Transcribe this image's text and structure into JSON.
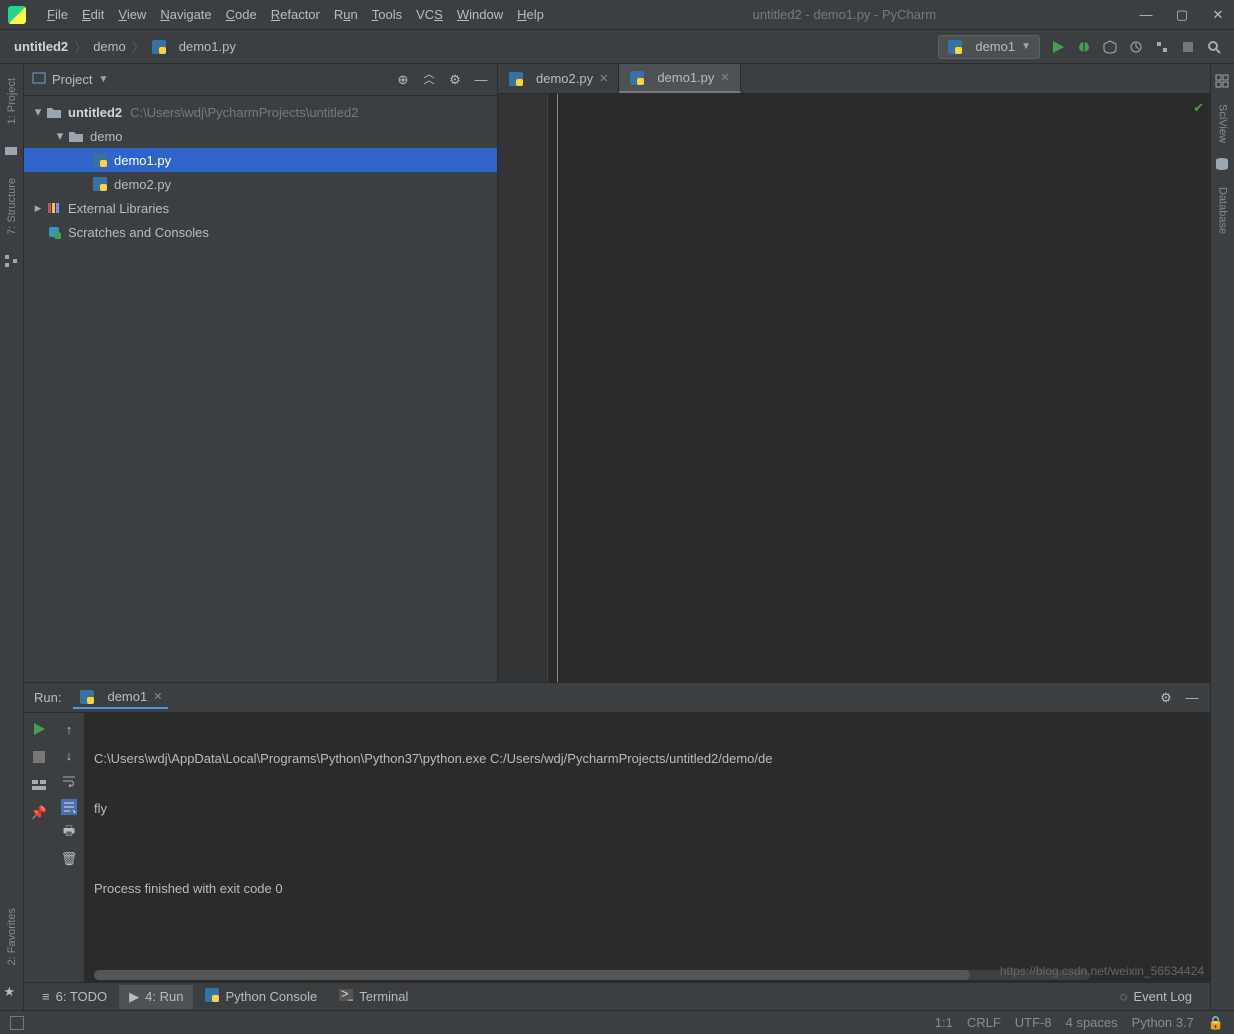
{
  "window": {
    "title": "untitled2 - demo1.py - PyCharm"
  },
  "menu": [
    "File",
    "Edit",
    "View",
    "Navigate",
    "Code",
    "Refactor",
    "Run",
    "Tools",
    "VCS",
    "Window",
    "Help"
  ],
  "breadcrumb": {
    "root": "untitled2",
    "mid": "demo",
    "file": "demo1.py"
  },
  "run_config": {
    "name": "demo1"
  },
  "project": {
    "panel_title": "Project",
    "tree": {
      "root": {
        "name": "untitled2",
        "path": "C:\\Users\\wdj\\PycharmProjects\\untitled2"
      },
      "demo": {
        "name": "demo"
      },
      "files": [
        "demo1.py",
        "demo2.py"
      ],
      "ext_lib": "External Libraries",
      "scratches": "Scratches and Consoles"
    }
  },
  "tabs": [
    {
      "label": "demo2.py",
      "active": false
    },
    {
      "label": "demo1.py",
      "active": true
    }
  ],
  "left_gutter": [
    "1: Project",
    "7: Structure"
  ],
  "right_gutter": [
    "SciView",
    "Database"
  ],
  "run": {
    "title": "Run:",
    "tab": "demo1",
    "output": [
      "C:\\Users\\wdj\\AppData\\Local\\Programs\\Python\\Python37\\python.exe C:/Users/wdj/PycharmProjects/untitled2/demo/de",
      "fly",
      "",
      "Process finished with exit code 0"
    ]
  },
  "bottom_tabs": {
    "todo": "6: TODO",
    "run": "4: Run",
    "pyconsole": "Python Console",
    "terminal": "Terminal",
    "eventlog": "Event Log"
  },
  "status": {
    "pos": "1:1",
    "eol": "CRLF",
    "enc": "UTF-8",
    "indent": "4 spaces",
    "sdk": "Python 3.7"
  },
  "left_favorites": "2: Favorites",
  "watermark": "https://blog.csdn.net/weixin_56534424"
}
